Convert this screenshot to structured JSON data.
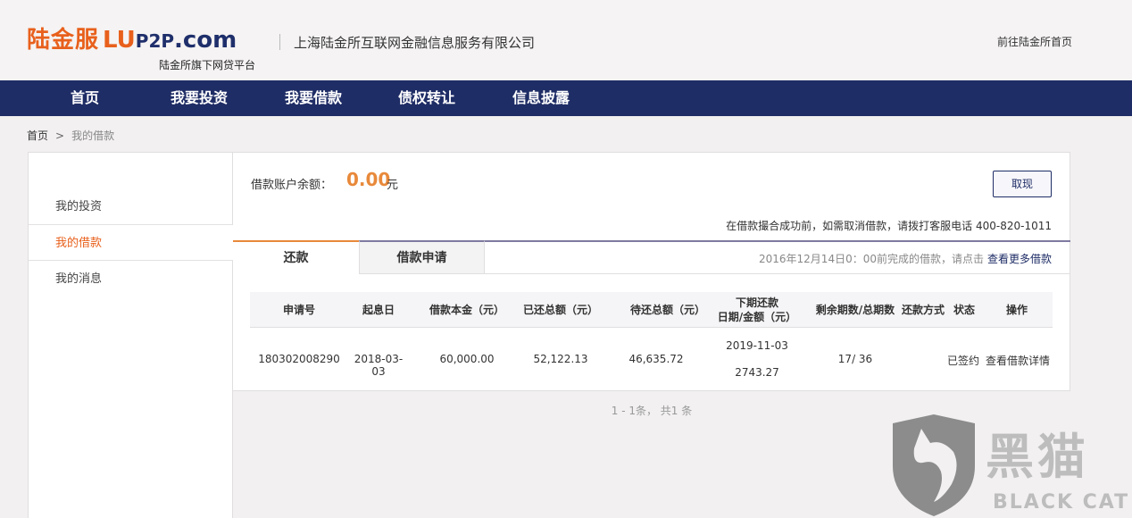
{
  "header": {
    "logo_cn": "陆金服",
    "logo_lu": "LU",
    "logo_p2p": "P2P",
    "logo_com": ".com",
    "logo_sub": "陆金所旗下网贷平台",
    "company": "上海陆金所互联网金融信息服务有限公司",
    "home_link": "前往陆金所首页"
  },
  "nav": {
    "items": [
      "首页",
      "我要投资",
      "我要借款",
      "债权转让",
      "信息披露"
    ]
  },
  "breadcrumb": {
    "home": "首页",
    "sep": ">",
    "current": "我的借款"
  },
  "sidebar": {
    "items": [
      "我的投资",
      "我的借款",
      "我的消息"
    ]
  },
  "account": {
    "balance_label": "借款账户余额：",
    "balance_value": "0.00",
    "balance_unit": "元",
    "withdraw_label": "取现",
    "notice": "在借款撮合成功前，如需取消借款，请拨打客服电话 400-820-1011"
  },
  "tabs": {
    "repay": "还款",
    "apply": "借款申请",
    "note": "2016年12月14日0：00前完成的借款，请点击",
    "more_link": "查看更多借款"
  },
  "table": {
    "headers": {
      "app_no": "申请号",
      "start_date": "起息日",
      "principal": "借款本金（元）",
      "repaid": "已还总额（元）",
      "pending": "待还总额（元）",
      "next_line1": "下期还款",
      "next_line2": "日期/金额（元）",
      "periods": "剩余期数/总期数",
      "method": "还款方式",
      "status": "状态",
      "action": "操作"
    },
    "row": {
      "app_no": "180302008290",
      "start_date": "2018-03-03",
      "principal": "60,000.00",
      "repaid": "52,122.13",
      "pending": "46,635.72",
      "next_date": "2019-11-03",
      "next_amount": "2743.27",
      "periods": "17/ 36",
      "method": "",
      "status": "已签约",
      "action": "查看借款详情"
    }
  },
  "pager": "1 - 1条， 共1 条",
  "watermark": {
    "cn": "黑猫",
    "en": "BLACK CAT"
  },
  "colors": {
    "brand_orange": "#e8601c",
    "nav_blue": "#1f2d66",
    "amount_orange": "#e8893a"
  }
}
